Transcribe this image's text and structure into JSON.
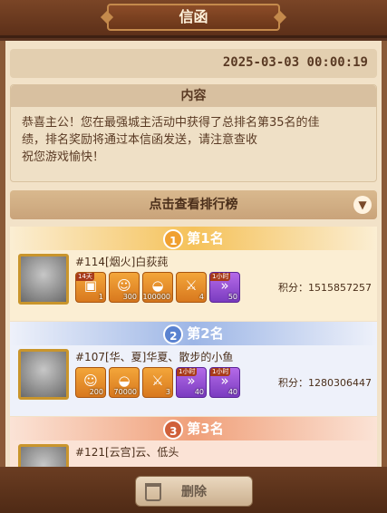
{
  "header": {
    "title": "信函"
  },
  "letter": {
    "date": "2025-03-03 00:00:19",
    "content_title": "内容",
    "content_lines": [
      "恭喜主公！您在最强城主活动中获得了总排名第35名的佳",
      "绩，排名奖励将通过本信函发送，请注意查收",
      "祝您游戏愉快！"
    ]
  },
  "ranking": {
    "toggle_label": "点击查看排行榜",
    "toggle_icon": "chevron-down-icon",
    "entries": [
      {
        "rank_label": "第1名",
        "badge": "1",
        "name": "#114[烟火]白荻莼",
        "score": "积分：1515857257",
        "items": [
          {
            "icon": "frame-icon",
            "count": "1",
            "tag": "14天"
          },
          {
            "icon": "hero-portrait-icon",
            "count": "300",
            "tag": ""
          },
          {
            "icon": "gold-ingot-icon",
            "count": "100000",
            "tag": ""
          },
          {
            "icon": "crossed-swords-icon",
            "count": "4",
            "tag": ""
          },
          {
            "icon": "speedup-icon",
            "count": "50",
            "tag": "1小时"
          }
        ]
      },
      {
        "rank_label": "第2名",
        "badge": "2",
        "name": "#107[华、夏]华夏、散步的小鱼",
        "score": "积分：1280306447",
        "items": [
          {
            "icon": "hero-portrait-icon",
            "count": "200",
            "tag": ""
          },
          {
            "icon": "gold-ingot-icon",
            "count": "70000",
            "tag": ""
          },
          {
            "icon": "crossed-swords-icon",
            "count": "3",
            "tag": ""
          },
          {
            "icon": "speedup-icon",
            "count": "40",
            "tag": "1小时"
          },
          {
            "icon": "speedup-icon",
            "count": "40",
            "tag": "1小时"
          }
        ]
      },
      {
        "rank_label": "第3名",
        "badge": "3",
        "name": "#121[云宫]云、低头",
        "score": "",
        "items": []
      }
    ]
  },
  "footer": {
    "delete_label": "删除"
  },
  "colors": {
    "rank1": "#f5c25a",
    "rank2": "#9db6e6",
    "rank3": "#f0a07a",
    "rank1_body": "#fbeed3",
    "rank2_body": "#eef1fa",
    "rank3_body": "#fbe3d6"
  }
}
